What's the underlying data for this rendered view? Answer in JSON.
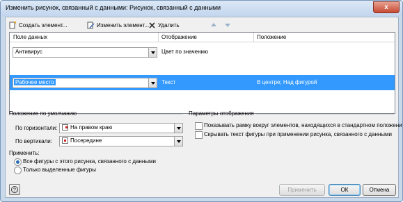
{
  "window": {
    "title": "Изменить рисунок, связанный с данными: Рисунок, связанный с данными",
    "close_label": "x"
  },
  "toolbar": {
    "create_label": "Создать элемент...",
    "edit_label": "Изменить элемент...",
    "delete_label": "Удалить"
  },
  "grid": {
    "columns": [
      "Поле данных",
      "Отображение",
      "Положение"
    ],
    "rows": [
      {
        "field": "Антивирус",
        "display": "Цвет по значению",
        "position": ""
      },
      {
        "field": "Рабочее место",
        "display": "Текст",
        "position": "В центре; Над фигурой"
      }
    ]
  },
  "default_position": {
    "heading": "Положение по умолчанию",
    "horizontal_label": "По горизонтали:",
    "horizontal_value": "На правом краю",
    "vertical_label": "По вертикали:",
    "vertical_value": "Посередине"
  },
  "display_params": {
    "heading": "Параметры отображения",
    "option1": "Показывать рамку вокруг элементов, находящихся в стандартном положении",
    "option2": "Скрывать текст фигуры при применении рисунка, связанного с данными"
  },
  "apply": {
    "heading": "Применить:",
    "option_all": "Все фигуры с этого рисунка, связанного с данными",
    "option_selected": "Только выделенные фигуры"
  },
  "buttons": {
    "apply": "Применить",
    "ok": "ОК",
    "cancel": "Отмена"
  }
}
